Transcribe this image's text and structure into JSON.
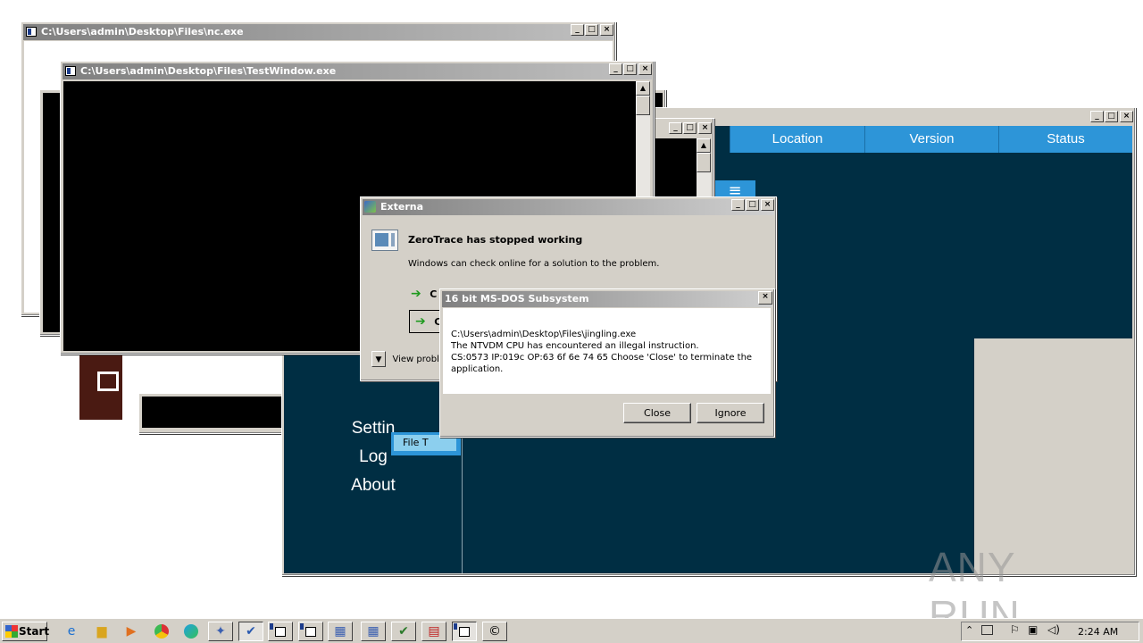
{
  "windows": {
    "nc": {
      "title": "C:\\Users\\admin\\Desktop\\Files\\nc.exe"
    },
    "testwindow": {
      "title": "C:\\Users\\admin\\Desktop\\Files\\TestWindow.exe"
    },
    "app": {
      "columns": [
        "Location",
        "Version",
        "Status"
      ],
      "menu": [
        "Settin",
        "Log",
        "About"
      ],
      "file_tab": "File T"
    },
    "externa": {
      "title": "Externa",
      "heading": "ZeroTrace has stopped working",
      "message": "Windows can check online for a solution to the problem.",
      "option1": "C",
      "option2": "C",
      "view_problem": "View probl"
    },
    "msdos": {
      "title": "16 bit MS-DOS Subsystem",
      "line1": "C:\\Users\\admin\\Desktop\\Files\\jingling.exe",
      "line2": "The NTVDM CPU has encountered an illegal instruction.",
      "line3": "CS:0573 IP:019c OP:63 6f 6e 74 65 Choose 'Close' to terminate the",
      "line4": "application.",
      "close_label": "Close",
      "ignore_label": "Ignore"
    }
  },
  "taskbar": {
    "start_label": "Start",
    "clock": "2:24 AM"
  },
  "watermark": "ANY RUN",
  "colors": {
    "app_bg": "#002e43",
    "column_header": "#2d95d8",
    "taskbar": "#d4d0c8"
  }
}
